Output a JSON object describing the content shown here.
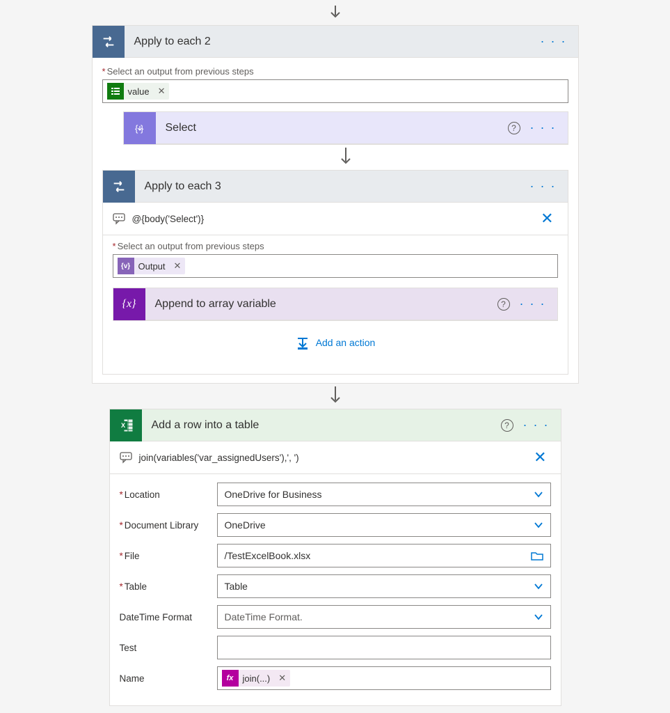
{
  "arrow_top": true,
  "apply_each_2": {
    "title": "Apply to each 2",
    "output_label": "Select an output from previous steps",
    "token": "value"
  },
  "select": {
    "title": "Select"
  },
  "apply_each_3": {
    "title": "Apply to each 3",
    "comment": "@{body('Select')}",
    "output_label": "Select an output from previous steps",
    "token": "Output"
  },
  "append": {
    "title": "Append to array variable"
  },
  "add_action": "Add an action",
  "excel": {
    "title": "Add a row into a table",
    "comment": "join(variables('var_assignedUsers'),', ')",
    "fields": {
      "location": {
        "label": "Location",
        "value": "OneDrive for Business",
        "required": true,
        "type": "dropdown"
      },
      "doclib": {
        "label": "Document Library",
        "value": "OneDrive",
        "required": true,
        "type": "dropdown"
      },
      "file": {
        "label": "File",
        "value": "/TestExcelBook.xlsx",
        "required": true,
        "type": "file"
      },
      "table": {
        "label": "Table",
        "value": "Table",
        "required": true,
        "type": "dropdown"
      },
      "dtformat": {
        "label": "DateTime Format",
        "value": "DateTime Format.",
        "required": false,
        "type": "dropdown"
      },
      "test": {
        "label": "Test",
        "value": "",
        "required": false,
        "type": "text"
      },
      "name": {
        "label": "Name",
        "token": "join(...)",
        "required": false,
        "type": "token"
      }
    }
  }
}
